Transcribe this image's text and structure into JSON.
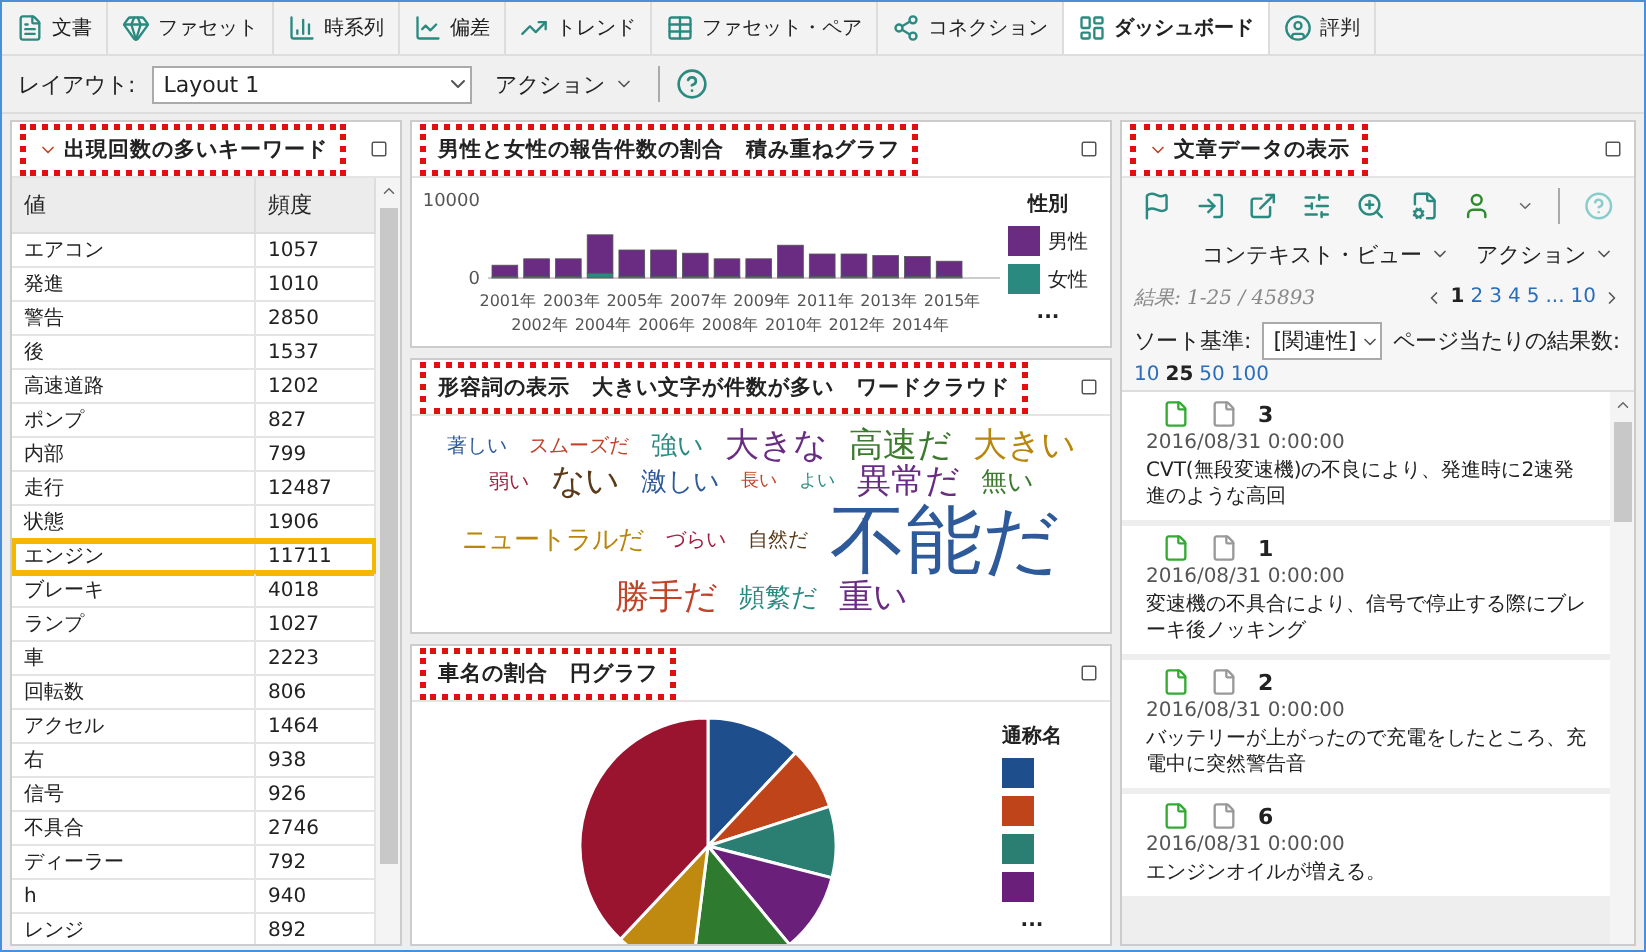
{
  "tabs": [
    {
      "label": "文書",
      "selected": false
    },
    {
      "label": "ファセット",
      "selected": false
    },
    {
      "label": "時系列",
      "selected": false
    },
    {
      "label": "偏差",
      "selected": false
    },
    {
      "label": "トレンド",
      "selected": false
    },
    {
      "label": "ファセット・ペア",
      "selected": false
    },
    {
      "label": "コネクション",
      "selected": false
    },
    {
      "label": "ダッシュボード",
      "selected": true
    },
    {
      "label": "評判",
      "selected": false
    }
  ],
  "toolbar": {
    "layout_label": "レイアウト:",
    "layout_value": "Layout 1",
    "action": "アクション"
  },
  "keyword_panel": {
    "title": "出現回数の多いキーワード",
    "highlighted": true,
    "columns": [
      "値",
      "頻度"
    ],
    "rows": [
      {
        "value": "エアコン",
        "count": "1057",
        "highlighted": false
      },
      {
        "value": "発進",
        "count": "1010",
        "highlighted": false
      },
      {
        "value": "警告",
        "count": "2850",
        "highlighted": false
      },
      {
        "value": "後",
        "count": "1537",
        "highlighted": false
      },
      {
        "value": "高速道路",
        "count": "1202",
        "highlighted": false
      },
      {
        "value": "ポンプ",
        "count": "827",
        "highlighted": false
      },
      {
        "value": "内部",
        "count": "799",
        "highlighted": false
      },
      {
        "value": "走行",
        "count": "12487",
        "highlighted": false
      },
      {
        "value": "状態",
        "count": "1906",
        "highlighted": false
      },
      {
        "value": "エンジン",
        "count": "11711",
        "highlighted": true
      },
      {
        "value": "ブレーキ",
        "count": "4018",
        "highlighted": false
      },
      {
        "value": "ランプ",
        "count": "1027",
        "highlighted": false
      },
      {
        "value": "車",
        "count": "2223",
        "highlighted": false
      },
      {
        "value": "回転数",
        "count": "806",
        "highlighted": false
      },
      {
        "value": "アクセル",
        "count": "1464",
        "highlighted": false
      },
      {
        "value": "右",
        "count": "938",
        "highlighted": false
      },
      {
        "value": "信号",
        "count": "926",
        "highlighted": false
      },
      {
        "value": "不具合",
        "count": "2746",
        "highlighted": false
      },
      {
        "value": "ディーラー",
        "count": "792",
        "highlighted": false
      },
      {
        "value": "h",
        "count": "940",
        "highlighted": false
      },
      {
        "value": "レンジ",
        "count": "892",
        "highlighted": false
      }
    ]
  },
  "gender_panel": {
    "title": "男性と女性の報告件数の割合　積み重ねグラフ",
    "highlighted": true,
    "legend_title": "性別",
    "legend_more": "...",
    "chart_data": {
      "type": "bar",
      "stacked": true,
      "categories": [
        "2001年",
        "2002年",
        "2003年",
        "2004年",
        "2005年",
        "2006年",
        "2007年",
        "2008年",
        "2009年",
        "2010年",
        "2011年",
        "2012年",
        "2013年",
        "2014年",
        "2015年"
      ],
      "yticks": [
        0,
        10000
      ],
      "ylim": [
        0,
        10000
      ],
      "series": [
        {
          "name": "男性",
          "color": "#6a2c82",
          "values": [
            1400,
            2200,
            2200,
            4800,
            3300,
            3300,
            2900,
            2200,
            2200,
            3900,
            2800,
            2800,
            2600,
            2500,
            1900
          ]
        },
        {
          "name": "女性",
          "color": "#2a8a80",
          "values": [
            200,
            200,
            200,
            600,
            200,
            200,
            200,
            200,
            200,
            200,
            200,
            200,
            200,
            200,
            200
          ]
        }
      ]
    }
  },
  "cloud_panel": {
    "title": "形容詞の表示　大きい文字が件数が多い　ワードクラウド",
    "highlighted": true,
    "words": [
      {
        "word": "著しい",
        "kind": "s",
        "color": "#2e5a9a"
      },
      {
        "word": "スムーズだ",
        "kind": "s",
        "color": "#c0442a"
      },
      {
        "word": "強い",
        "kind": "m",
        "color": "#2a8a80"
      },
      {
        "word": "大きな",
        "kind": "l",
        "color": "#6a2c82"
      },
      {
        "word": "高速だ",
        "kind": "l",
        "color": "#3c7a2e"
      },
      {
        "word": "大きい",
        "kind": "l",
        "color": "#b8860b"
      },
      {
        "word": "弱い",
        "kind": "s",
        "color": "#a02040"
      },
      {
        "word": "ない",
        "kind": "l",
        "color": "#5a3a1a"
      },
      {
        "word": "激しい",
        "kind": "m",
        "color": "#2e5a9a"
      },
      {
        "word": "長い",
        "kind": "xs",
        "color": "#c0442a"
      },
      {
        "word": "よい",
        "kind": "xs",
        "color": "#2a8a80"
      },
      {
        "word": "異常だ",
        "kind": "l",
        "color": "#6a2c82"
      },
      {
        "word": "無い",
        "kind": "m",
        "color": "#3c7a2e"
      },
      {
        "word": "ニュートラルだ",
        "kind": "m",
        "color": "#b8860b"
      },
      {
        "word": "づらい",
        "kind": "s",
        "color": "#a02040"
      },
      {
        "word": "自然だ",
        "kind": "s",
        "color": "#5a3a1a"
      },
      {
        "word": "不能だ",
        "kind": "xl",
        "color": "#2e5a9a"
      },
      {
        "word": "勝手だ",
        "kind": "l",
        "color": "#c0442a"
      },
      {
        "word": "頻繁だ",
        "kind": "m",
        "color": "#2a8a80"
      },
      {
        "word": "重い",
        "kind": "l",
        "color": "#6a2c82"
      }
    ]
  },
  "car_panel": {
    "title": "車名の割合　円グラフ",
    "highlighted": true,
    "legend_title": "通称名",
    "legend_more": "...",
    "legend": [
      {
        "color": "#1f4e8c"
      },
      {
        "color": "#c0441a"
      },
      {
        "color": "#2a7f72"
      },
      {
        "color": "#6a1f7a"
      }
    ]
  },
  "docs_panel": {
    "title": "文章データの表示",
    "highlighted": true,
    "context_view": "コンテキスト・ビュー",
    "action": "アクション",
    "results": "結果: 1-25 / 45893",
    "pages": [
      {
        "label": "1",
        "selected": true
      },
      {
        "label": "2",
        "selected": false
      },
      {
        "label": "3",
        "selected": false
      },
      {
        "label": "4",
        "selected": false
      },
      {
        "label": "5",
        "selected": false
      },
      {
        "label": "...",
        "selected": false
      },
      {
        "label": "10",
        "selected": false
      }
    ],
    "sort_label": "ソート基準:",
    "sort_value": "[関連性]",
    "per_page_label": "ページ当たりの結果数:",
    "per_page": [
      {
        "label": "10",
        "selected": false
      },
      {
        "label": "25",
        "selected": true
      },
      {
        "label": "50",
        "selected": false
      },
      {
        "label": "100",
        "selected": false
      }
    ],
    "items": [
      {
        "number": "3",
        "date": "2016/08/31 0:00:00",
        "text": "CVT(無段変速機)の不良により、発進時に2速発進のような高回"
      },
      {
        "number": "1",
        "date": "2016/08/31 0:00:00",
        "text": "変速機の不具合により、信号で停止する際にブレーキ後ノッキング"
      },
      {
        "number": "2",
        "date": "2016/08/31 0:00:00",
        "text": "バッテリーが上がったので充電をしたところ、充電中に突然警告音"
      },
      {
        "number": "6",
        "date": "2016/08/31 0:00:00",
        "text": "エンジンオイルが増える。"
      }
    ]
  }
}
